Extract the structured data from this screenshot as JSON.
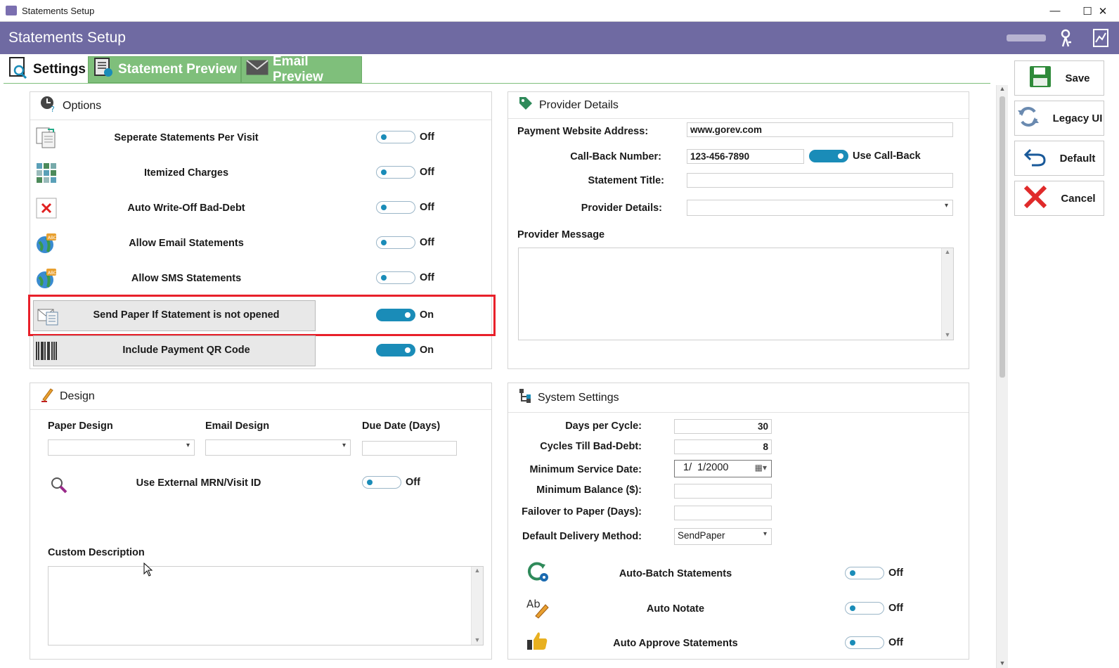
{
  "window": {
    "title": "Statements Setup"
  },
  "header": {
    "title": "Statements Setup"
  },
  "tabs": [
    {
      "label": "Settings"
    },
    {
      "label": "Statement Preview"
    },
    {
      "label": "Email Preview"
    }
  ],
  "options": {
    "title": "Options",
    "items": [
      {
        "label": "Seperate Statements Per Visit",
        "state": "Off"
      },
      {
        "label": "Itemized Charges",
        "state": "Off"
      },
      {
        "label": "Auto Write-Off Bad-Debt",
        "state": "Off"
      },
      {
        "label": "Allow Email Statements",
        "state": "Off"
      },
      {
        "label": "Allow SMS Statements",
        "state": "Off"
      },
      {
        "label": "Send Paper If Statement is not opened",
        "state": "On"
      },
      {
        "label": "Include Payment QR Code",
        "state": "On"
      }
    ]
  },
  "provider": {
    "title": "Provider Details",
    "website_label": "Payment Website Address:",
    "website_value": "www.gorev.com",
    "callback_label": "Call-Back Number:",
    "callback_value": "123-456-7890",
    "use_callback_label": "Use Call-Back",
    "statement_title_label": "Statement Title:",
    "statement_title_value": "",
    "provider_details_label": "Provider Details:",
    "provider_details_value": "",
    "message_label": "Provider Message",
    "message_value": ""
  },
  "design": {
    "title": "Design",
    "paper_label": "Paper Design",
    "email_label": "Email Design",
    "due_label": "Due Date (Days)",
    "mrn_label": "Use External MRN/Visit ID",
    "mrn_state": "Off",
    "custom_label": "Custom Description",
    "custom_value": ""
  },
  "system": {
    "title": "System Settings",
    "days_label": "Days per Cycle:",
    "days_value": "30",
    "cycles_label": "Cycles Till Bad-Debt:",
    "cycles_value": "8",
    "min_date_label": "Minimum Service Date:",
    "min_date_value": "1/  1/2000",
    "min_balance_label": "Minimum Balance ($):",
    "min_balance_value": "",
    "failover_label": "Failover to Paper (Days):",
    "failover_value": "",
    "delivery_label": "Default Delivery Method:",
    "delivery_value": "SendPaper",
    "toggles": [
      {
        "label": "Auto-Batch Statements",
        "state": "Off"
      },
      {
        "label": "Auto Notate",
        "state": "Off"
      },
      {
        "label": "Auto Approve Statements",
        "state": "Off"
      }
    ]
  },
  "actions": {
    "save": "Save",
    "legacy": "Legacy UI",
    "default": "Default",
    "cancel": "Cancel"
  },
  "colors": {
    "header": "#6f6aa2",
    "tab_inactive": "#7fbf7b",
    "toggle_on": "#1a8cb8",
    "highlight": "#e8202a"
  }
}
